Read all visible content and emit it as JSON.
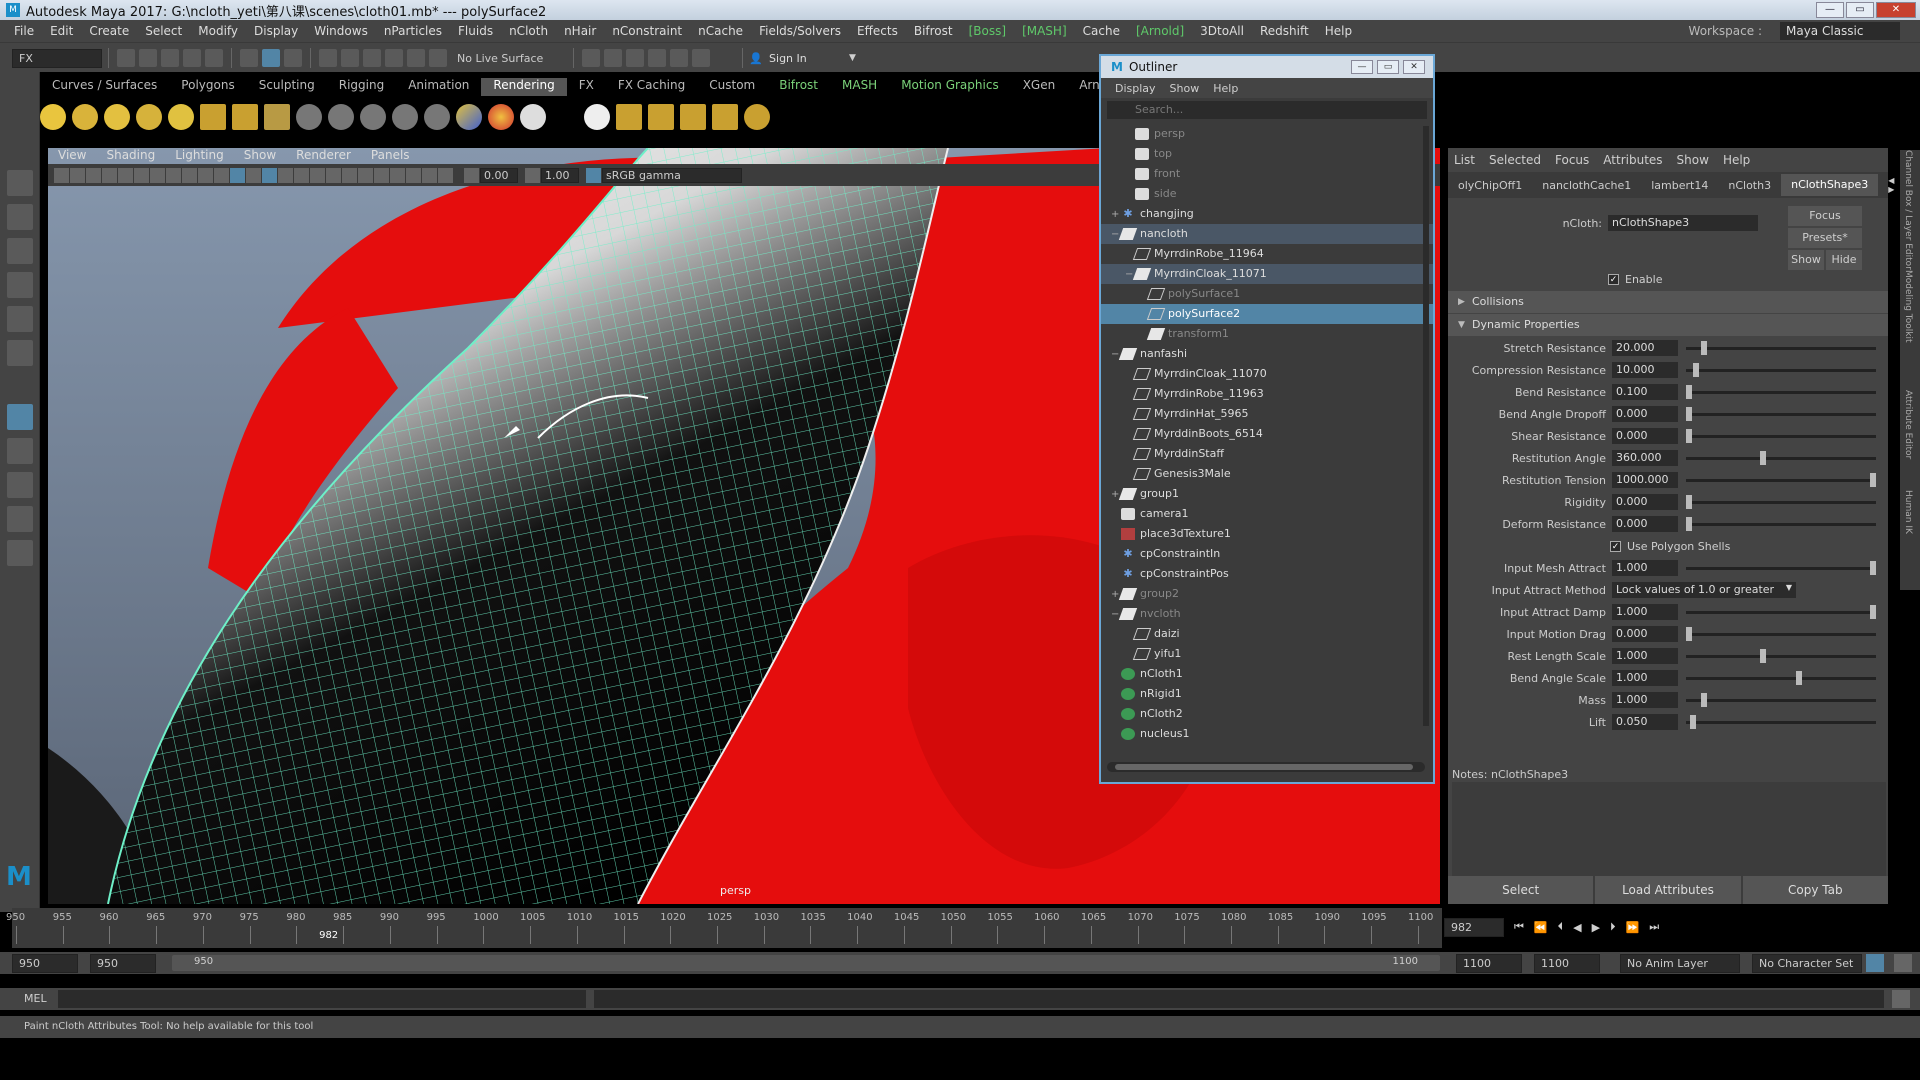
{
  "window": {
    "title": "Autodesk Maya 2017: G:\\ncloth_yeti\\第八课\\scenes\\cloth01.mb*   ---   polySurface2"
  },
  "menubar": {
    "items": [
      "File",
      "Edit",
      "Create",
      "Select",
      "Modify",
      "Display",
      "Windows",
      "nParticles",
      "Fluids",
      "nCloth",
      "nHair",
      "nConstraint",
      "nCache",
      "Fields/Solvers",
      "Effects",
      "Bifrost",
      "[Boss]",
      "[MASH]",
      "Cache",
      "[Arnold]",
      "3DtoAll",
      "Redshift",
      "Help"
    ],
    "workspace_label": "Workspace :",
    "workspace_value": "Maya Classic"
  },
  "statusline": {
    "mode": "FX",
    "live_surface": "No Live Surface",
    "sign_in": "Sign In"
  },
  "shelf": {
    "tabs": [
      "Curves / Surfaces",
      "Polygons",
      "Sculpting",
      "Rigging",
      "Animation",
      "Rendering",
      "FX",
      "FX Caching",
      "Custom",
      "Bifrost",
      "MASH",
      "Motion Graphics",
      "XGen",
      "Arnold"
    ],
    "active": "Rendering"
  },
  "viewport": {
    "menu": [
      "View",
      "Shading",
      "Lighting",
      "Show",
      "Renderer",
      "Panels"
    ],
    "field_a": "0.00",
    "field_b": "1.00",
    "color_space": "sRGB gamma",
    "camera_label": "persp"
  },
  "outliner": {
    "title": "Outliner",
    "menu": [
      "Display",
      "Show",
      "Help"
    ],
    "search_placeholder": "Search...",
    "items": [
      {
        "label": "persp",
        "icon": "camera-icon",
        "depth": 1,
        "state": "dim"
      },
      {
        "label": "top",
        "icon": "camera-icon",
        "depth": 1,
        "state": "dim"
      },
      {
        "label": "front",
        "icon": "camera-icon",
        "depth": 1,
        "state": "dim"
      },
      {
        "label": "side",
        "icon": "camera-icon",
        "depth": 1,
        "state": "dim"
      },
      {
        "label": "changjing",
        "icon": "constraint-icon",
        "depth": 0,
        "state": "normal",
        "expand": "+"
      },
      {
        "label": "nancloth",
        "icon": "group-icon",
        "depth": 0,
        "state": "part",
        "expand": "−"
      },
      {
        "label": "MyrrdinRobe_11964",
        "icon": "mesh-icon",
        "depth": 1,
        "state": "normal"
      },
      {
        "label": "MyrrdinCloak_11071",
        "icon": "group-icon",
        "depth": 1,
        "state": "part",
        "expand": "−"
      },
      {
        "label": "polySurface1",
        "icon": "mesh-icon",
        "depth": 2,
        "state": "dim"
      },
      {
        "label": "polySurface2",
        "icon": "mesh-icon",
        "depth": 2,
        "state": "sel"
      },
      {
        "label": "transform1",
        "icon": "group-icon",
        "depth": 2,
        "state": "dim"
      },
      {
        "label": "nanfashi",
        "icon": "group-icon",
        "depth": 0,
        "state": "normal",
        "expand": "−"
      },
      {
        "label": "MyrrdinCloak_11070",
        "icon": "mesh-icon",
        "depth": 1,
        "state": "normal"
      },
      {
        "label": "MyrrdinRobe_11963",
        "icon": "mesh-icon",
        "depth": 1,
        "state": "normal"
      },
      {
        "label": "MyrrdinHat_5965",
        "icon": "mesh-icon",
        "depth": 1,
        "state": "normal"
      },
      {
        "label": "MyrddinBoots_6514",
        "icon": "mesh-icon",
        "depth": 1,
        "state": "normal"
      },
      {
        "label": "MyrddinStaff",
        "icon": "mesh-icon",
        "depth": 1,
        "state": "normal"
      },
      {
        "label": "Genesis3Male",
        "icon": "mesh-icon",
        "depth": 1,
        "state": "normal"
      },
      {
        "label": "group1",
        "icon": "group-icon",
        "depth": 0,
        "state": "normal",
        "expand": "+"
      },
      {
        "label": "camera1",
        "icon": "camera-icon",
        "depth": 0,
        "state": "normal"
      },
      {
        "label": "place3dTexture1",
        "icon": "texture-icon",
        "depth": 0,
        "state": "normal"
      },
      {
        "label": "cpConstraintIn",
        "icon": "constraint-icon",
        "depth": 0,
        "state": "normal"
      },
      {
        "label": "cpConstraintPos",
        "icon": "constraint-icon",
        "depth": 0,
        "state": "normal"
      },
      {
        "label": "group2",
        "icon": "group-icon",
        "depth": 0,
        "state": "dim",
        "expand": "+"
      },
      {
        "label": "nvcloth",
        "icon": "group-icon",
        "depth": 0,
        "state": "dim",
        "expand": "−"
      },
      {
        "label": "daizi",
        "icon": "mesh-icon",
        "depth": 1,
        "state": "normal"
      },
      {
        "label": "yifu1",
        "icon": "mesh-icon",
        "depth": 1,
        "state": "normal"
      },
      {
        "label": "nCloth1",
        "icon": "ncloth-icon",
        "depth": 0,
        "state": "normal"
      },
      {
        "label": "nRigid1",
        "icon": "nrigid-icon",
        "depth": 0,
        "state": "normal"
      },
      {
        "label": "nCloth2",
        "icon": "ncloth-icon",
        "depth": 0,
        "state": "normal"
      },
      {
        "label": "nucleus1",
        "icon": "nucleus-icon",
        "depth": 0,
        "state": "normal"
      }
    ]
  },
  "attribute_editor": {
    "menu": [
      "List",
      "Selected",
      "Focus",
      "Attributes",
      "Show",
      "Help"
    ],
    "tabs": [
      "olyChipOff1",
      "nanclothCache1",
      "lambert14",
      "nCloth3",
      "nClothShape3"
    ],
    "active_tab": "nClothShape3",
    "node_label": "nCloth:",
    "node_value": "nClothShape3",
    "focus": "Focus",
    "presets": "Presets*",
    "show": "Show",
    "hide": "Hide",
    "enable_label": "Enable",
    "sections": {
      "collisions": "Collisions",
      "dynamic": "Dynamic Properties"
    },
    "fields": [
      {
        "label": "Stretch Resistance",
        "value": "20.000",
        "level": 0.08
      },
      {
        "label": "Compression Resistance",
        "value": "10.000",
        "level": 0.04
      },
      {
        "label": "Bend Resistance",
        "value": "0.100",
        "level": 0.0
      },
      {
        "label": "Bend Angle Dropoff",
        "value": "0.000",
        "level": 0.0
      },
      {
        "label": "Shear Resistance",
        "value": "0.000",
        "level": 0.0
      },
      {
        "label": "Restitution Angle",
        "value": "360.000",
        "level": 0.4
      },
      {
        "label": "Restitution Tension",
        "value": "1000.000",
        "level": 1.0
      },
      {
        "label": "Rigidity",
        "value": "0.000",
        "level": 0.0
      },
      {
        "label": "Deform Resistance",
        "value": "0.000",
        "level": 0.0
      }
    ],
    "use_polygon_shells": "Use Polygon Shells",
    "fields2": [
      {
        "label": "Input Mesh Attract",
        "value": "1.000",
        "level": 1.0
      }
    ],
    "input_attract_method_label": "Input Attract Method",
    "input_attract_method_value": "Lock values of 1.0 or greater",
    "fields3": [
      {
        "label": "Input Attract Damp",
        "value": "1.000",
        "level": 1.0
      },
      {
        "label": "Input Motion Drag",
        "value": "0.000",
        "level": 0.0
      },
      {
        "label": "Rest Length Scale",
        "value": "1.000",
        "level": 0.4
      },
      {
        "label": "Bend Angle Scale",
        "value": "1.000",
        "level": 0.6
      },
      {
        "label": "Mass",
        "value": "1.000",
        "level": 0.08
      },
      {
        "label": "Lift",
        "value": "0.050",
        "level": 0.02
      }
    ],
    "notes": "Notes:  nClothShape3",
    "buttons": [
      "Select",
      "Load Attributes",
      "Copy Tab"
    ]
  },
  "side_tabs": [
    "Channel Box / Layer Editor",
    "Modeling Toolkit",
    "Attribute Editor",
    "Human IK"
  ],
  "timeline": {
    "start": 950,
    "end": 1100,
    "step": 5,
    "current": 982,
    "current_field": "982"
  },
  "range": {
    "start_a": "950",
    "start_b": "950",
    "bar_start": "950",
    "bar_end": "1100",
    "end_a": "1100",
    "end_b": "1100",
    "anim_layer": "No Anim Layer",
    "char_set": "No Character Set"
  },
  "cmdline": {
    "label": "MEL"
  },
  "help_line": "Paint nCloth Attributes Tool: No help available for this tool",
  "colors": {
    "accent": "#5285a6",
    "cloth_red": "#e50d0d",
    "wire": "#6ef0c8"
  }
}
